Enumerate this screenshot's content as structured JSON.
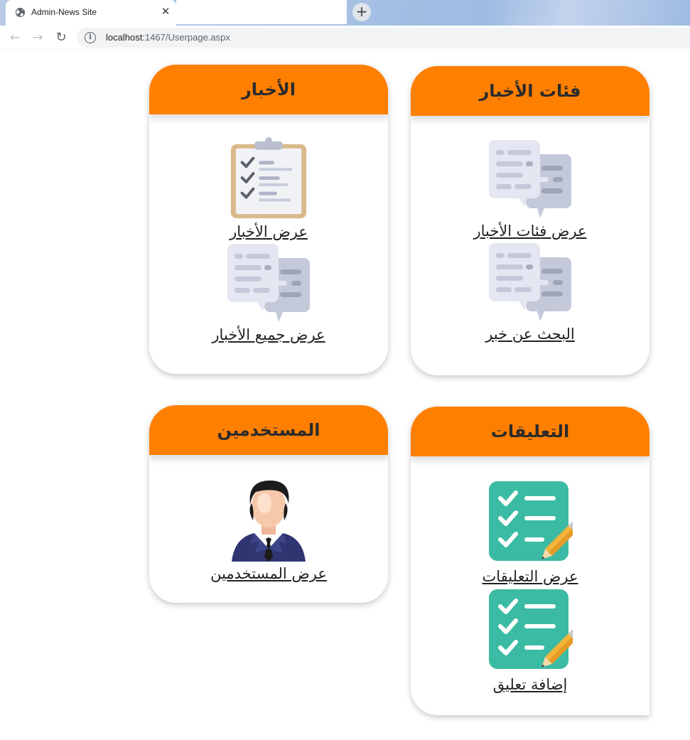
{
  "browser": {
    "tab_title": "Admin-News Site",
    "tab_close": "✕",
    "new_tab": "+",
    "url_host": "localhost",
    "url_path": ":1467/Userpage.aspx",
    "back": "←",
    "forward": "→",
    "reload": "↻"
  },
  "cards": {
    "categories": {
      "title": "فئات الأخبار",
      "items": [
        {
          "label": "عرض فئات الأخبار",
          "icon": "chat-bubbles-icon"
        },
        {
          "label": "البحث عن خبر",
          "icon": "chat-bubbles-icon"
        }
      ]
    },
    "news": {
      "title": "الأخبار",
      "items": [
        {
          "label": "عرض الأخبار",
          "icon": "clipboard-checklist-icon"
        },
        {
          "label": "عرض جميع الأخبار",
          "icon": "chat-bubbles-icon"
        }
      ]
    },
    "comments": {
      "title": "التعليقات",
      "items": [
        {
          "label": "عرض التعليقات",
          "icon": "checklist-pencil-icon"
        },
        {
          "label": "إضافة تعليق",
          "icon": "checklist-pencil-icon"
        }
      ]
    },
    "users": {
      "title": "المستخدمين",
      "items": [
        {
          "label": "عرض المستخدمين",
          "icon": "user-avatar-icon"
        }
      ]
    }
  },
  "colors": {
    "header_orange": "#ff7f00",
    "checklist_teal": "#3bbba3"
  }
}
